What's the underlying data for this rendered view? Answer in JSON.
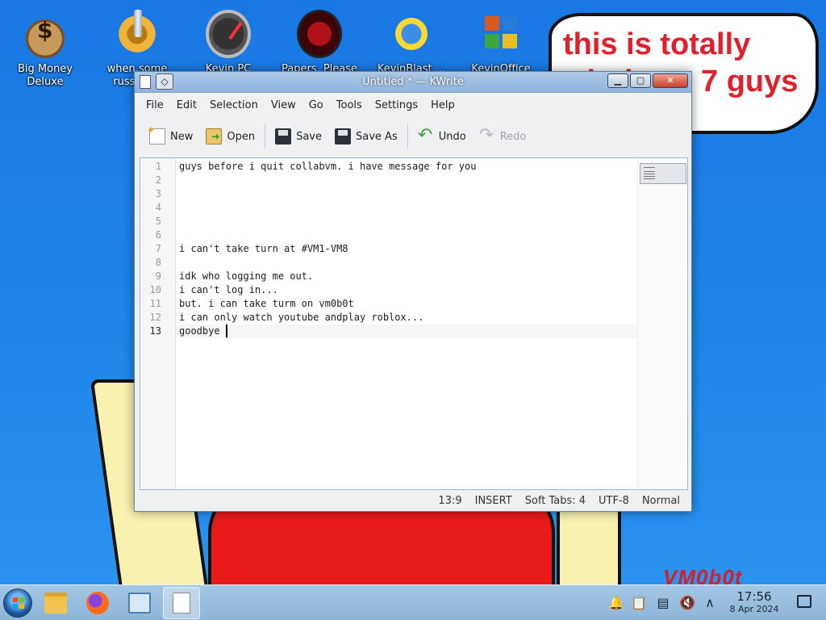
{
  "desktop": {
    "icons": [
      {
        "label": "Big Money Deluxe",
        "icon": "money-bag-icon"
      },
      {
        "label": "when some russian...",
        "icon": "gear-icon"
      },
      {
        "label": "Kevin PC Optimizer Ho...",
        "icon": "gauge-icon"
      },
      {
        "label": "Papers, Please",
        "icon": "papers-please-icon"
      },
      {
        "label": "KevinBlast ...",
        "icon": "blast-icon"
      },
      {
        "label": "KevinOffice 2009",
        "icon": "office-icon"
      }
    ],
    "speech_bubble_text": "this is totally windows 7 guys",
    "watermark": "VM0b0t"
  },
  "window": {
    "title": "Untitled * — KWrite",
    "controls": {
      "menu": "◇",
      "minimize": "▁",
      "maximize": "▢",
      "close": "✕"
    },
    "menu": [
      "File",
      "Edit",
      "Selection",
      "View",
      "Go",
      "Tools",
      "Settings",
      "Help"
    ],
    "toolbar": {
      "new": "New",
      "open": "Open",
      "save": "Save",
      "save_as": "Save As",
      "undo": "Undo",
      "redo": "Redo"
    },
    "editor": {
      "current_line": 13,
      "lines": [
        "guys before i quit collabvm. i have message for you",
        "",
        "",
        "",
        "",
        "",
        "i can't take turn at #VM1-VM8",
        "",
        "idk who logging me out.",
        "i can't log in...",
        "but. i can take turm on vm0b0t",
        "i can only watch youtube andplay roblox...",
        "goodbye "
      ]
    },
    "status": {
      "position": "13:9",
      "mode": "INSERT",
      "tabs": "Soft Tabs: 4",
      "encoding": "UTF-8",
      "highlighting": "Normal"
    }
  },
  "taskbar": {
    "apps": [
      {
        "name": "file-manager",
        "icon": "folder-icon"
      },
      {
        "name": "firefox",
        "icon": "firefox-icon"
      },
      {
        "name": "system-settings",
        "icon": "settings-icon"
      },
      {
        "name": "kwrite",
        "icon": "kwrite-icon",
        "active": true
      }
    ],
    "tray": {
      "notifications": "🔔",
      "clipboard": "📋",
      "device": "▤",
      "volume": "🔇",
      "expand": "∧"
    },
    "clock": {
      "time": "17:56",
      "date": "8 Apr 2024"
    }
  }
}
